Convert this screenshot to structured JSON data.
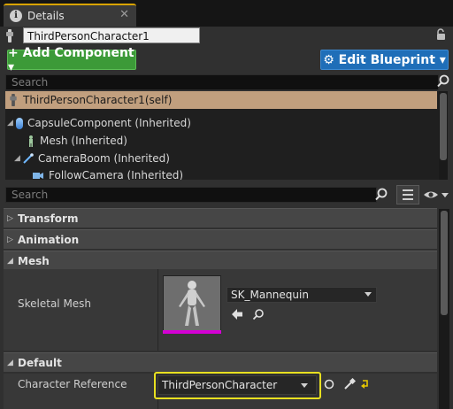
{
  "tab": {
    "title": "Details",
    "close": "✕"
  },
  "object_name": "ThirdPersonCharacter1",
  "toolbar": {
    "add_component_label": "+ Add Component ▾",
    "edit_blueprint_label": "⚙ Edit Blueprint ▾"
  },
  "component_search": {
    "placeholder": "Search"
  },
  "component_tree": {
    "self": "ThirdPersonCharacter1(self)",
    "items": [
      {
        "label": "CapsuleComponent (Inherited)",
        "icon": "capsule-icon"
      },
      {
        "label": "Mesh (Inherited)",
        "icon": "skeletal-mesh-icon"
      },
      {
        "label": "CameraBoom (Inherited)",
        "icon": "spring-arm-icon"
      },
      {
        "label": "FollowCamera (Inherited)",
        "icon": "camera-icon"
      }
    ]
  },
  "details_search": {
    "placeholder": "Search"
  },
  "categories": {
    "transform": "Transform",
    "animation": "Animation",
    "mesh": "Mesh",
    "default": "Default"
  },
  "mesh": {
    "label": "Skeletal Mesh",
    "value": "SK_Mannequin"
  },
  "default": {
    "label": "Character Reference",
    "value": "ThirdPersonCharacter"
  },
  "colors": {
    "add_component": "#3c9a38",
    "edit_blueprint": "#1f6eb8",
    "selection": "#c19f7e",
    "highlight": "#e8e020",
    "asset_bar": "#d400d4"
  }
}
